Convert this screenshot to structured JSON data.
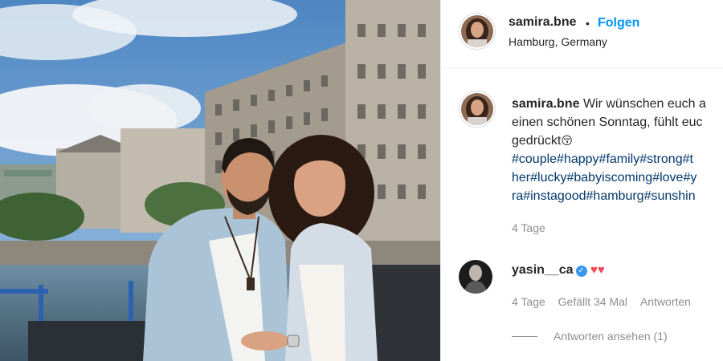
{
  "post": {
    "author": "samira.bne",
    "follow_separator": "•",
    "follow_label": "Folgen",
    "location": "Hamburg, Germany"
  },
  "caption": {
    "username": "samira.bne",
    "line1": "Wir wünschen euch a",
    "line2": "einen schönen Sonntag, fühlt euc",
    "line3": "gedrückt",
    "line3_emoji": "😚",
    "hashtags_line1": "#couple#happy#family#strong#t",
    "hashtags_line2": "her#lucky#babyiscoming#love#y",
    "hashtags_line3": "ra#instagood#hamburg#sunshin",
    "age": "4 Tage"
  },
  "comment": {
    "username": "yasin__ca",
    "verified_glyph": "✓",
    "hearts": "♥♥",
    "age": "4 Tage",
    "likes": "Gefällt 34 Mal",
    "reply_label": "Antworten",
    "view_replies": "Antworten ansehen (1)"
  },
  "icons": {
    "verified": "verified-badge-icon",
    "hearts": "red-heart-emoji",
    "emoji": "kissing-face-emoji"
  },
  "colors": {
    "link_blue": "#0095f6",
    "hashtag": "#00376b",
    "secondary_text": "#8e8e8e",
    "verified": "#3897f0",
    "heart": "#ed4956"
  }
}
